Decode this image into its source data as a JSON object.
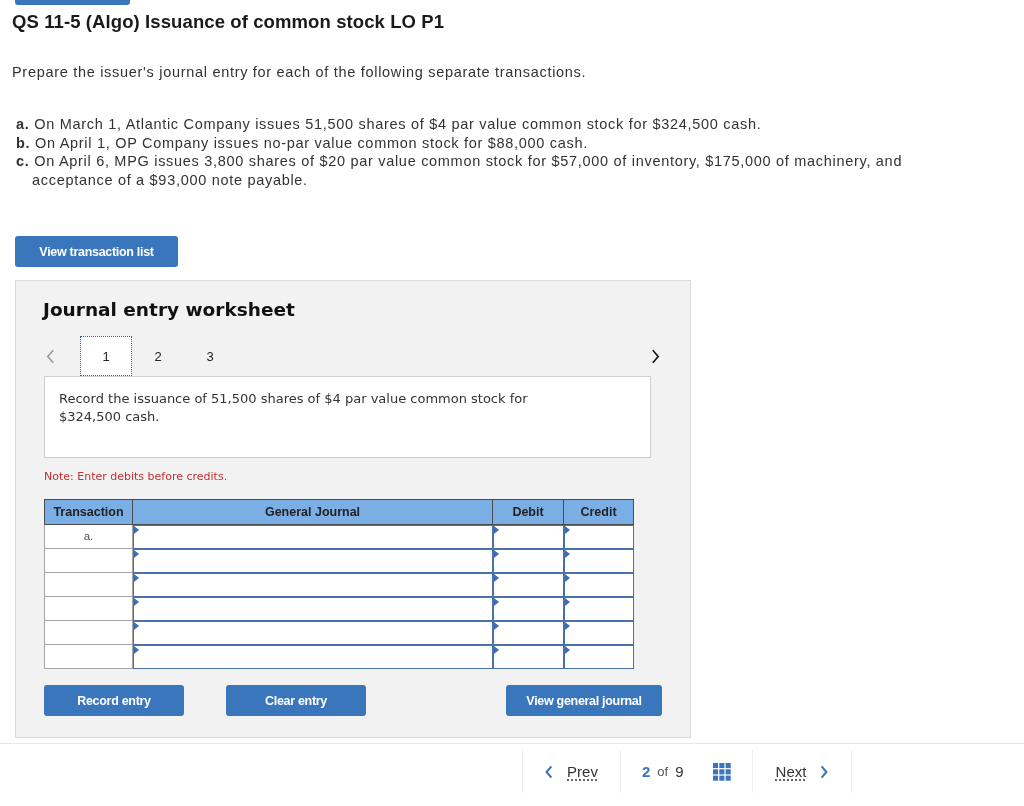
{
  "title": "QS 11-5 (Algo) Issuance of common stock LO P1",
  "instructions": "Prepare the issuer's journal entry for each of the following separate transactions.",
  "transactions": [
    "**a.** On March 1, Atlantic Company issues 51,500 shares of $4 par value common stock for $324,500 cash.",
    "**b.** On April 1, OP Company issues no-par value common stock for $88,000 cash.",
    "**c.** On April 6, MPG issues 3,800 shares of $20 par value common stock for $57,000 of inventory, $175,000 of machinery, and acceptance of a $93,000 note payable."
  ],
  "view_transaction_list_button": "View transaction list",
  "worksheet": {
    "title": "Journal entry worksheet",
    "prev_disabled": true,
    "next_disabled": false,
    "tabs": [
      {
        "label": "1",
        "selected": true
      },
      {
        "label": "2",
        "selected": false
      },
      {
        "label": "3",
        "selected": false
      }
    ],
    "description": "Record the issuance of 51,500 shares of $4 par value common stock for $324,500 cash.",
    "note": "Note: Enter debits before credits.",
    "journal_table": {
      "columns": [
        "Transaction",
        "General Journal",
        "Debit",
        "Credit"
      ],
      "rows": [
        {
          "transaction": "a."
        },
        {},
        {},
        {},
        {},
        {}
      ]
    },
    "buttons": [
      "Record entry",
      "Clear entry",
      "View general journal"
    ]
  },
  "pager": {
    "prev": "Prev",
    "current_page": "2",
    "of": "of",
    "total_pages": "9",
    "next": "Next"
  }
}
